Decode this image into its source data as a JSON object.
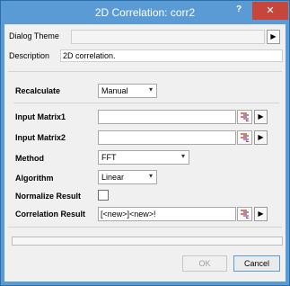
{
  "window": {
    "title": "2D Correlation: corr2",
    "help_label": "?",
    "close_label": "✕"
  },
  "theme": {
    "label": "Dialog Theme",
    "value": ""
  },
  "description": {
    "label": "Description",
    "value": "2D correlation."
  },
  "recalculate": {
    "label": "Recalculate",
    "value": "Manual"
  },
  "input_matrix1": {
    "label": "Input Matrix1",
    "value": ""
  },
  "input_matrix2": {
    "label": "Input Matrix2",
    "value": ""
  },
  "method": {
    "label": "Method",
    "value": "FFT"
  },
  "algorithm": {
    "label": "Algorithm",
    "value": "Linear"
  },
  "normalize": {
    "label": "Normalize Result",
    "checked": false
  },
  "correlation_result": {
    "label": "Correlation Result",
    "value": "[<new>]<new>!"
  },
  "buttons": {
    "ok": "OK",
    "cancel": "Cancel"
  },
  "icons": {
    "arrow": "▶",
    "dropdown": "▾"
  },
  "colors": {
    "titlebar": "#5a9bd5",
    "close": "#c7463c"
  }
}
